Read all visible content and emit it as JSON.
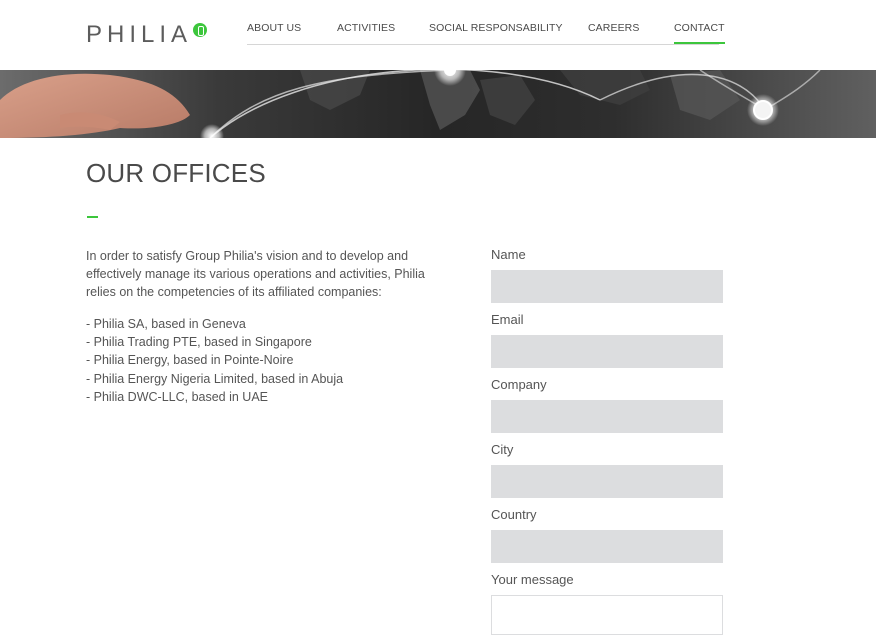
{
  "header": {
    "logo_text": "PHILIA",
    "nav": [
      {
        "label": "ABOUT US",
        "active": false
      },
      {
        "label": "ACTIVITIES",
        "active": false
      },
      {
        "label": "SOCIAL RESPONSABILITY",
        "active": false
      },
      {
        "label": "CAREERS",
        "active": false
      },
      {
        "label": "CONTACT",
        "active": true
      }
    ]
  },
  "colors": {
    "accent": "#3cc63c",
    "input_bg": "#dcdddf",
    "text": "#555555"
  },
  "main": {
    "title": "OUR OFFICES",
    "intro": "In order to satisfy Group Philia's vision and to develop and effectively manage its various operations and activities, Philia relies on the competencies of its affiliated companies:",
    "companies": [
      "- Philia SA, based in Geneva",
      "- Philia Trading PTE, based in Singapore",
      "- Philia Energy, based in Pointe-Noire",
      "- Philia Energy Nigeria Limited, based in Abuja",
      "- Philia DWC-LLC, based in UAE"
    ]
  },
  "form": {
    "fields": [
      {
        "label": "Name",
        "value": ""
      },
      {
        "label": "Email",
        "value": ""
      },
      {
        "label": "Company",
        "value": ""
      },
      {
        "label": "City",
        "value": ""
      },
      {
        "label": "Country",
        "value": ""
      }
    ],
    "message_label": "Your message",
    "message_value": ""
  }
}
